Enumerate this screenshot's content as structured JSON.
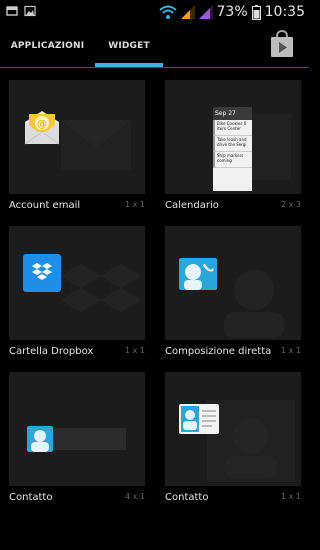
{
  "status_bar": {
    "battery_percent": "73%",
    "time": "10:35",
    "icons": [
      "notification-icon",
      "image-icon",
      "wifi-icon",
      "signal-icon",
      "signal-icon",
      "battery-icon"
    ]
  },
  "tabs": [
    {
      "label": "APPLICAZIONI",
      "selected": false
    },
    {
      "label": "WIDGET",
      "selected": true
    }
  ],
  "store_icon": "play-store-icon",
  "accent_color": "#33b5e5",
  "widgets": [
    {
      "label": "Account email",
      "size": "1 x 1",
      "icon": "email-icon"
    },
    {
      "label": "Calendario",
      "size": "2 x 3",
      "icon": "calendar-widget",
      "calendar": {
        "date": "Sep 27",
        "items": [
          "Bike Cookies 6 Item Center",
          "Take leash and drive the Sergi",
          "Ship markers coming"
        ]
      }
    },
    {
      "label": "Cartella Dropbox",
      "size": "1 x 1",
      "icon": "dropbox-icon"
    },
    {
      "label": "Composizione diretta",
      "size": "1 x 1",
      "icon": "direct-dial-icon"
    },
    {
      "label": "Contatto",
      "size": "4 x 1",
      "icon": "contact-icon"
    },
    {
      "label": "Contatto",
      "size": "1 x 1",
      "icon": "contact-card-icon"
    }
  ]
}
